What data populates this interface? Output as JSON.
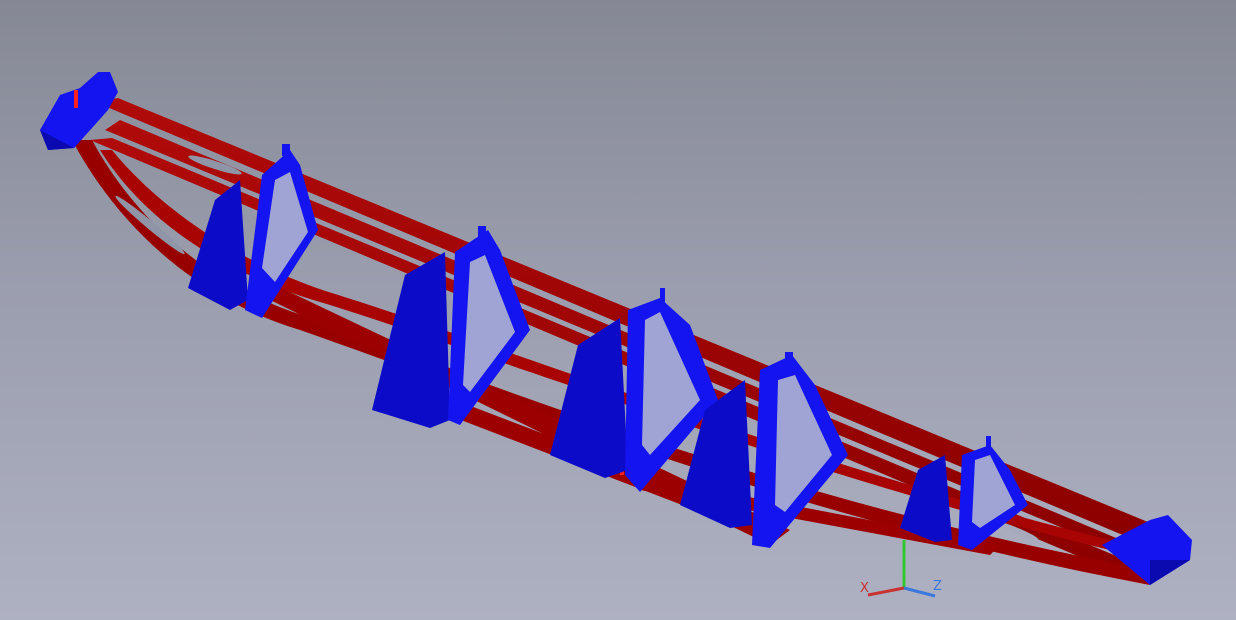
{
  "viewport": {
    "background_top": "#858894",
    "background_bottom": "#aeb1c2"
  },
  "model": {
    "beam_color": "#a10000",
    "beam_highlight": "#c81414",
    "rib_color": "#1414f0",
    "rib_shade": "#0a0ab0",
    "rib_count": 6
  },
  "triad": {
    "x_label": "X",
    "y_label": "Y",
    "z_label": "Z",
    "x_color": "#c83232",
    "y_color": "#32c832",
    "z_color": "#3c78dc"
  }
}
